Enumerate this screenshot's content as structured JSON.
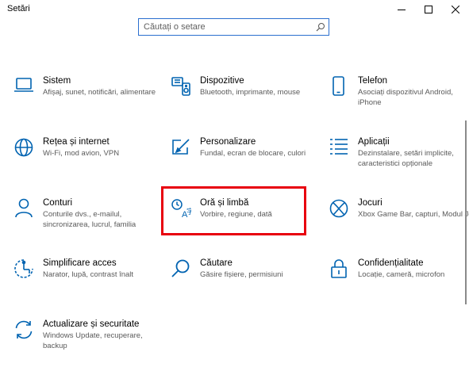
{
  "window": {
    "title": "Setări"
  },
  "search": {
    "placeholder": "Căutați o setare"
  },
  "colors": {
    "accent": "#0063b1",
    "highlight": "#e8000f"
  },
  "categories": [
    {
      "name": "Sistem",
      "desc": "Afișaj, sunet, notificări, alimentare",
      "icon": "laptop-icon"
    },
    {
      "name": "Dispozitive",
      "desc": "Bluetooth, imprimante, mouse",
      "icon": "keyboard-speaker-icon"
    },
    {
      "name": "Telefon",
      "desc": "Asociați dispozitivul Android, iPhone",
      "icon": "phone-icon"
    },
    {
      "name": "Rețea și internet",
      "desc": "Wi-Fi, mod avion, VPN",
      "icon": "globe-icon"
    },
    {
      "name": "Personalizare",
      "desc": "Fundal, ecran de blocare, culori",
      "icon": "brush-icon"
    },
    {
      "name": "Aplicații",
      "desc": "Dezinstalare, setări implicite, caracteristici opționale",
      "icon": "apps-list-icon"
    },
    {
      "name": "Conturi",
      "desc": "Conturile dvs., e-mailul, sincronizarea, lucrul, familia",
      "icon": "person-icon"
    },
    {
      "name": "Oră și limbă",
      "desc": "Vorbire, regiune, dată",
      "icon": "time-language-icon"
    },
    {
      "name": "Jocuri",
      "desc": "Xbox Game Bar, capturi, Modul Joc",
      "icon": "xbox-icon"
    },
    {
      "name": "Simplificare acces",
      "desc": "Narator, lupă, contrast înalt",
      "icon": "ease-of-access-icon"
    },
    {
      "name": "Căutare",
      "desc": "Găsire fișiere, permisiuni",
      "icon": "magnifier-icon"
    },
    {
      "name": "Confidențialitate",
      "desc": "Locație, cameră, microfon",
      "icon": "lock-icon"
    },
    {
      "name": "Actualizare și securitate",
      "desc": "Windows Update, recuperare, backup",
      "icon": "update-icon"
    }
  ]
}
